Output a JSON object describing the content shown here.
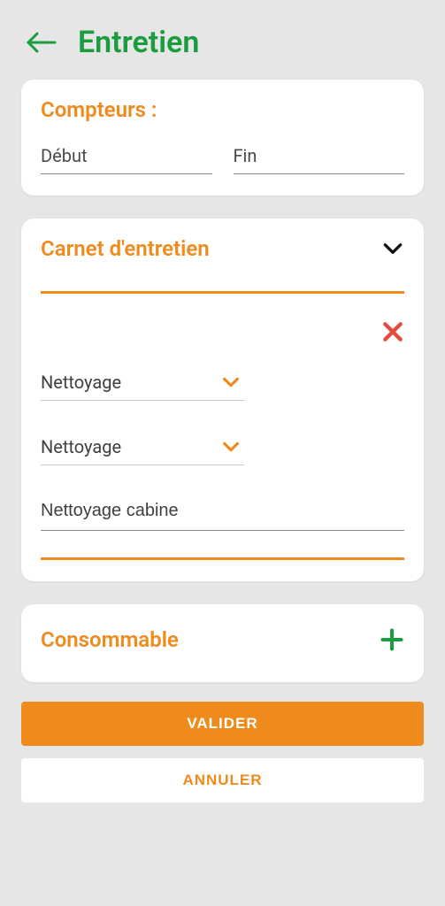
{
  "header": {
    "title": "Entretien"
  },
  "compteurs": {
    "title": "Compteurs :",
    "debut_label": "Début",
    "fin_label": "Fin"
  },
  "carnet": {
    "title": "Carnet d'entretien",
    "select1": "Nettoyage",
    "select2": "Nettoyage",
    "input_value": "Nettoyage cabine"
  },
  "consommable": {
    "title": "Consommable"
  },
  "actions": {
    "valider": "VALIDER",
    "annuler": "ANNULER"
  },
  "colors": {
    "accent_green": "#1a9c3f",
    "accent_orange": "#ef8b1c",
    "danger": "#e54a3f"
  }
}
